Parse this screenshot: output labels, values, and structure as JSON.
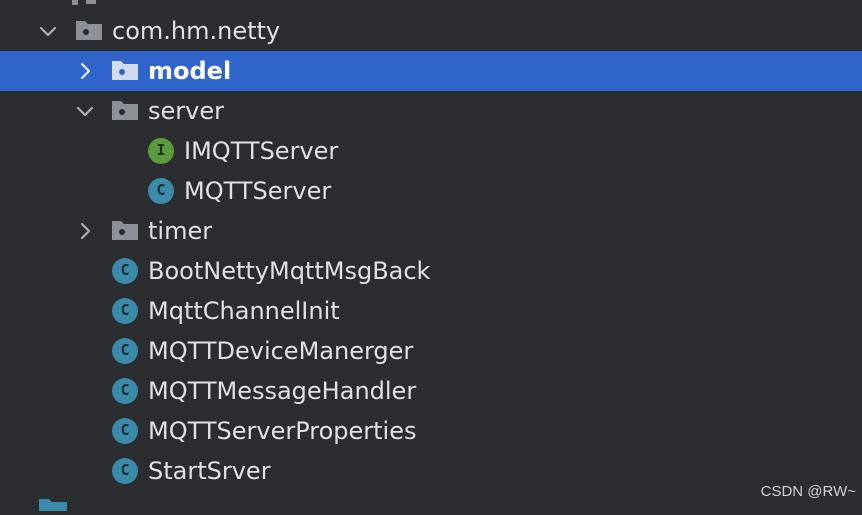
{
  "tree": {
    "items": [
      {
        "label": "com.hm.netty",
        "kind": "package",
        "expanded": true,
        "selected": false
      },
      {
        "label": "model",
        "kind": "package",
        "expanded": false,
        "selected": true
      },
      {
        "label": "server",
        "kind": "package",
        "expanded": true,
        "selected": false
      },
      {
        "label": "IMQTTServer",
        "kind": "interface",
        "badge": "I",
        "selected": false
      },
      {
        "label": "MQTTServer",
        "kind": "class",
        "badge": "C",
        "selected": false
      },
      {
        "label": "timer",
        "kind": "package",
        "expanded": false,
        "selected": false
      },
      {
        "label": "BootNettyMqttMsgBack",
        "kind": "class",
        "badge": "C",
        "selected": false
      },
      {
        "label": "MqttChannelInit",
        "kind": "class",
        "badge": "C",
        "selected": false
      },
      {
        "label": "MQTTDeviceManerger",
        "kind": "class",
        "badge": "C",
        "selected": false
      },
      {
        "label": "MQTTMessageHandler",
        "kind": "class",
        "badge": "C",
        "selected": false
      },
      {
        "label": "MQTTServerProperties",
        "kind": "class",
        "badge": "C",
        "selected": false
      },
      {
        "label": "StartSrver",
        "kind": "class",
        "badge": "C",
        "selected": false
      }
    ]
  },
  "watermark": "CSDN @RW~",
  "colors": {
    "background": "#2b2d30",
    "selection": "#2f65ca",
    "text": "#dfe1e5",
    "class_badge": "#3b8bab",
    "interface_badge": "#5a9c3d",
    "folder": "#8c9097"
  },
  "icons": {
    "expanded": "chevron-down-icon",
    "collapsed": "chevron-right-icon",
    "package": "package-folder-icon",
    "class": "class-icon",
    "interface": "interface-icon"
  }
}
